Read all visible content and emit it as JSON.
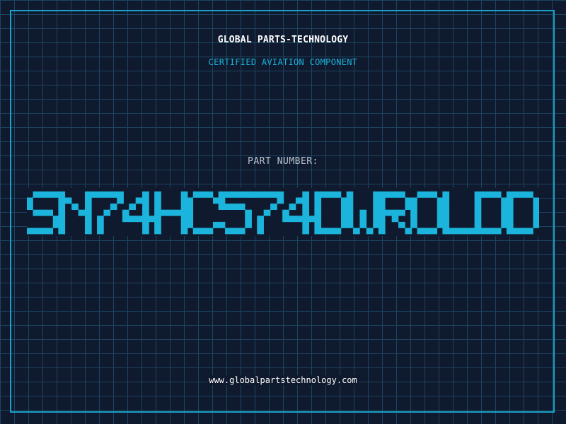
{
  "header": {
    "company": "GLOBAL PARTS-TECHNOLOGY",
    "subtitle": "CERTIFIED AVIATION COMPONENT"
  },
  "part": {
    "label": "PART NUMBER:",
    "number": "SN74HC574DWROLDD"
  },
  "footer": {
    "website": "www.globalpartstechnology.com"
  },
  "colors": {
    "background": "#101a2e",
    "grid": "#1c4460",
    "accent": "#1ab4dc",
    "frame": "#1aa3c8",
    "text": "#ffffff",
    "label": "#b8c2cf"
  }
}
